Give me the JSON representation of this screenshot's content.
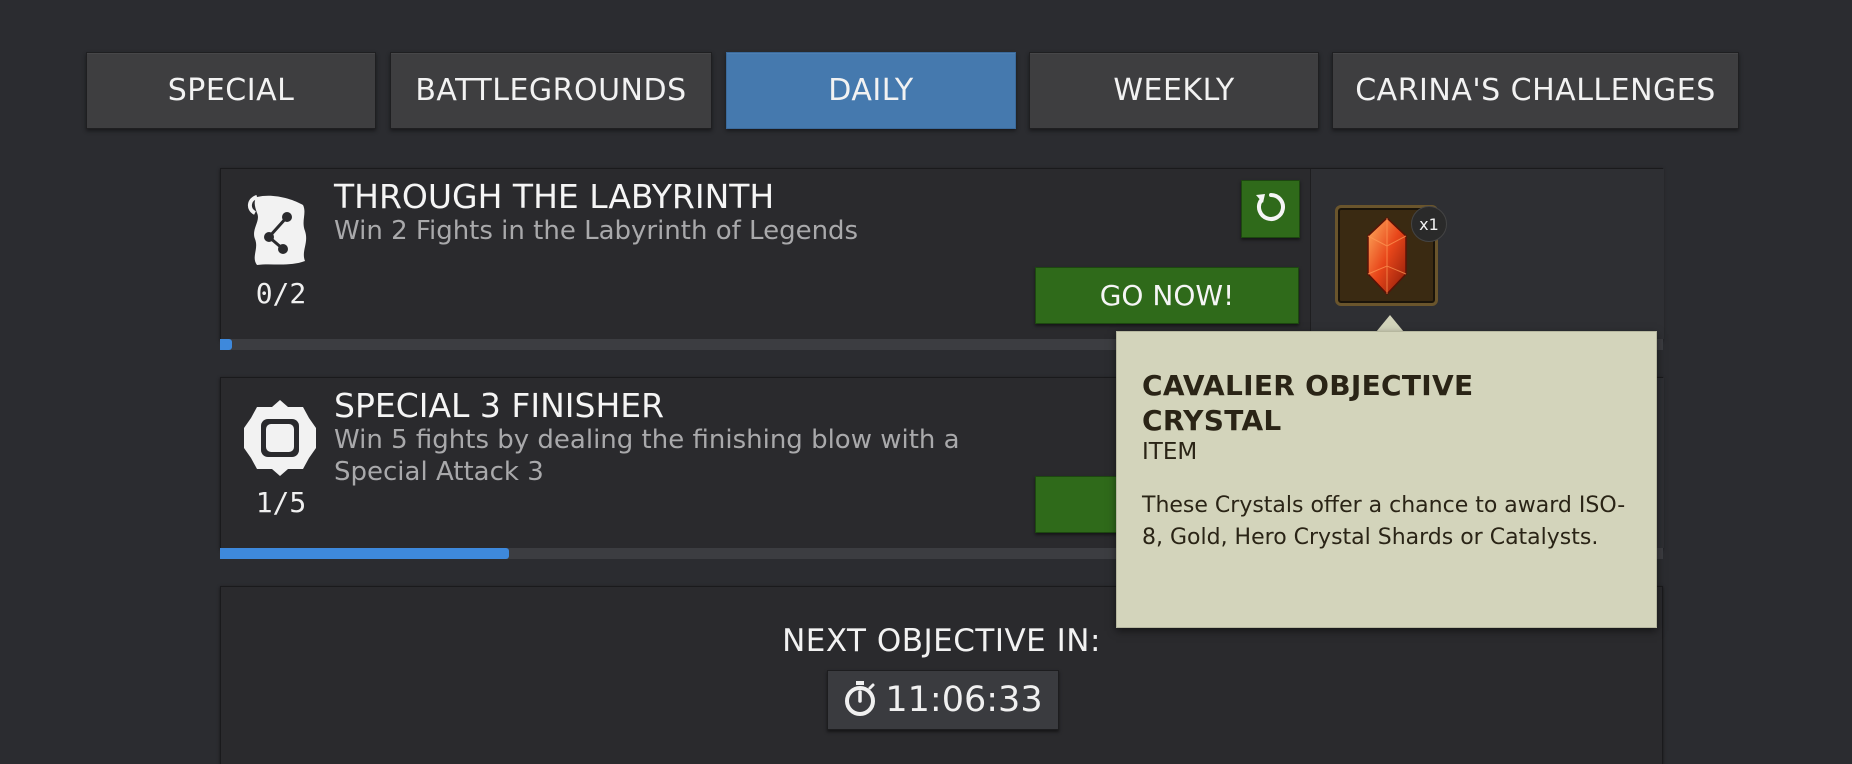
{
  "tabs": [
    {
      "label": "SPECIAL",
      "active": false
    },
    {
      "label": "BATTLEGROUNDS",
      "active": false
    },
    {
      "label": "DAILY",
      "active": true
    },
    {
      "label": "WEEKLY",
      "active": false
    },
    {
      "label": "CARINA'S CHALLENGES",
      "active": false
    }
  ],
  "objectives": [
    {
      "title": "THROUGH THE LABYRINTH",
      "description": "Win 2 Fights in the Labyrinth of Legends",
      "count": "0/2",
      "progress": 0.0,
      "go_label": "GO NOW!",
      "icon": "scroll-map-icon",
      "reward": {
        "name": "Cavalier Objective Crystal",
        "quantity": "x1",
        "icon": "red-crystal-icon"
      }
    },
    {
      "title": "SPECIAL 3 FINISHER",
      "description": "Win 5 fights by dealing the finishing blow with a Special Attack 3",
      "count": "1/5",
      "progress": 0.2,
      "icon": "octagon-badge-icon"
    }
  ],
  "timer": {
    "heading": "NEXT OBJECTIVE IN:",
    "value": "11:06:33",
    "icon": "stopwatch-icon"
  },
  "tooltip": {
    "title": "CAVALIER OBJECTIVE CRYSTAL",
    "type": "ITEM",
    "description": "These Crystals offer a chance to award ISO-8, Gold, Hero Crystal Shards or Catalysts."
  },
  "colors": {
    "background": "#2b2c30",
    "active_tab": "#4579ae",
    "go_button": "#2f6a1a",
    "progress": "#3e89dc",
    "tooltip_bg": "#d3d4bb"
  }
}
